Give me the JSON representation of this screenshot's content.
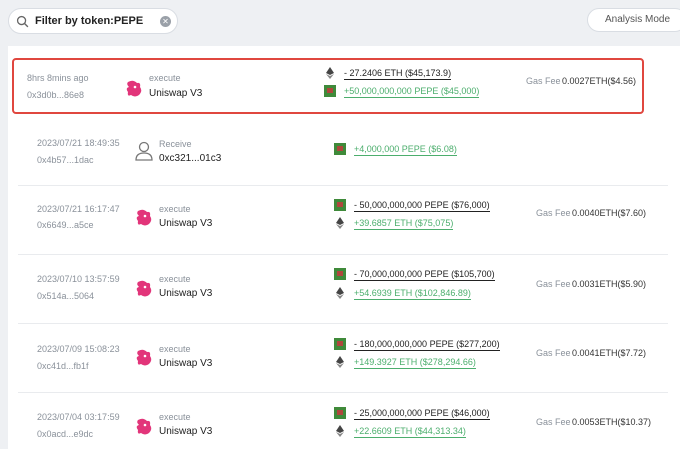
{
  "search": {
    "value": "Filter by token:PEPE"
  },
  "mode_button": {
    "label": "Analysis Mode"
  },
  "gas_label": "Gas Fee",
  "rows": [
    {
      "time": "8hrs 8mins ago",
      "hash": "0x3d0b...86e8",
      "action": "execute",
      "counterparty": "Uniswap V3",
      "line1": "- 27.2406 ETH ($45,173.9)",
      "line2": "+50,000,000,000 PEPE ($45,000)",
      "gas": "0.0027ETH($4.56)"
    },
    {
      "time": "2023/07/21 18:49:35",
      "hash": "0x4b57...1dac",
      "action": "Receive",
      "counterparty": "0xc321...01c3",
      "line1": "+4,000,000 PEPE ($6.08)"
    },
    {
      "time": "2023/07/21 16:17:47",
      "hash": "0x6649...a5ce",
      "action": "execute",
      "counterparty": "Uniswap V3",
      "line1": "- 50,000,000,000 PEPE ($76,000)",
      "line2": "+39.6857 ETH ($75,075)",
      "gas": "0.0040ETH($7.60)"
    },
    {
      "time": "2023/07/10 13:57:59",
      "hash": "0x514a...5064",
      "action": "execute",
      "counterparty": "Uniswap V3",
      "line1": "- 70,000,000,000 PEPE ($105,700)",
      "line2": "+54.6939 ETH ($102,846.89)",
      "gas": "0.0031ETH($5.90)"
    },
    {
      "time": "2023/07/09 15:08:23",
      "hash": "0xc41d...fb1f",
      "action": "execute",
      "counterparty": "Uniswap V3",
      "line1": "- 180,000,000,000 PEPE ($277,200)",
      "line2": "+149.3927 ETH ($278,294.66)",
      "gas": "0.0041ETH($7.72)"
    },
    {
      "time": "2023/07/04 03:17:59",
      "hash": "0x0acd...e9dc",
      "action": "execute",
      "counterparty": "Uniswap V3",
      "line1": "- 25,000,000,000 PEPE ($46,000)",
      "line2": "+22.6609 ETH ($44,313.34)",
      "gas": "0.0053ETH($10.37)"
    }
  ],
  "icons": {
    "search": "search-icon",
    "clear": "clear-icon",
    "uniswap": "uniswap-unicorn-icon",
    "user": "user-icon",
    "eth": "eth-icon",
    "pepe": "pepe-icon"
  },
  "colors": {
    "highlight": "#e0473f",
    "positive": "#4cae6d"
  }
}
